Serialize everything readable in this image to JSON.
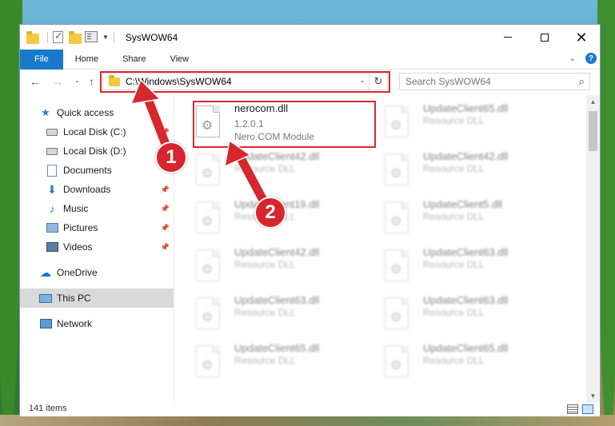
{
  "window": {
    "title": "SysWOW64"
  },
  "ribbon": {
    "tabs": [
      "File",
      "Home",
      "Share",
      "View"
    ]
  },
  "address": {
    "path": "C:\\Windows\\SysWOW64",
    "search_placeholder": "Search SysWOW64"
  },
  "sidebar": {
    "items": [
      {
        "label": "Quick access"
      },
      {
        "label": "Local Disk (C:)"
      },
      {
        "label": "Local Disk (D:)"
      },
      {
        "label": "Documents"
      },
      {
        "label": "Downloads"
      },
      {
        "label": "Music"
      },
      {
        "label": "Pictures"
      },
      {
        "label": "Videos"
      },
      {
        "label": "OneDrive"
      },
      {
        "label": "This PC"
      },
      {
        "label": "Network"
      }
    ]
  },
  "files": {
    "highlighted": {
      "name": "nerocom.dll",
      "version": "1.2.0.1",
      "description": "Nero COM Module"
    },
    "others": [
      {
        "name": "UpdateClient65.dll",
        "type": "Resource DLL"
      },
      {
        "name": "UpdateClient42.dll",
        "type": "Resource DLL"
      },
      {
        "name": "UpdateClient42.dll",
        "type": "Resource DLL"
      },
      {
        "name": "UpdateClient19.dll",
        "type": "Resource DLL"
      },
      {
        "name": "UpdateClient5.dll",
        "type": "Resource DLL"
      },
      {
        "name": "UpdateClient42.dll",
        "type": "Resource DLL"
      },
      {
        "name": "UpdateClient63.dll",
        "type": "Resource DLL"
      },
      {
        "name": "UpdateClient63.dll",
        "type": "Resource DLL"
      },
      {
        "name": "UpdateClient63.dll",
        "type": "Resource DLL"
      },
      {
        "name": "UpdateClient65.dll",
        "type": "Resource DLL"
      },
      {
        "name": "UpdateClient65.dll",
        "type": "Resource DLL"
      }
    ]
  },
  "status": {
    "item_count": "141 items"
  },
  "annotations": {
    "badge1": "1",
    "badge2": "2",
    "color": "#d6262e"
  },
  "icons": {
    "close": "close-icon",
    "maximize": "maximize-icon",
    "minimize": "minimize-icon",
    "refresh": "refresh-icon",
    "search": "search-icon"
  },
  "colors": {
    "file_tab": "#1979ca",
    "highlight_border": "#d9282f"
  }
}
